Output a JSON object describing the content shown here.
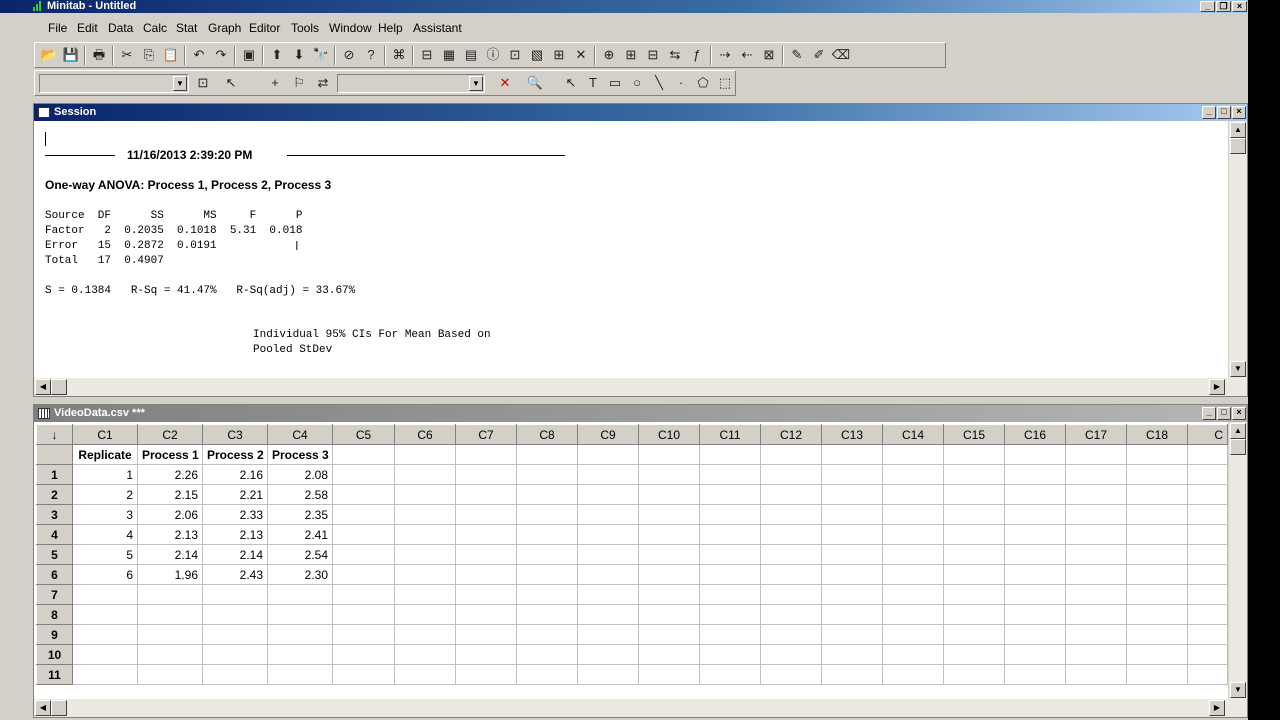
{
  "app": {
    "title": "Minitab - Untitled"
  },
  "menu": [
    "File",
    "Edit",
    "Data",
    "Calc",
    "Stat",
    "Graph",
    "Editor",
    "Tools",
    "Window",
    "Help",
    "Assistant"
  ],
  "session": {
    "title": "Session",
    "timestamp": "11/16/2013 2:39:20 PM",
    "heading": "One-way ANOVA: Process 1, Process 2, Process 3",
    "anova_lines": [
      "Source  DF      SS      MS     F      P",
      "Factor   2  0.2035  0.1018  5.31  0.018",
      "Error   15  0.2872  0.0191",
      "Total   17  0.4907"
    ],
    "summary_line": "S = 0.1384   R-Sq = 41.47%   R-Sq(adj) = 33.67%",
    "ci_lines": [
      "Individual 95% CIs For Mean Based on",
      "Pooled StDev"
    ]
  },
  "worksheet": {
    "title": "VideoData.csv ***",
    "corner_label": "↓",
    "columns": [
      "C1",
      "C2",
      "C3",
      "C4",
      "C5",
      "C6",
      "C7",
      "C8",
      "C9",
      "C10",
      "C11",
      "C12",
      "C13",
      "C14",
      "C15",
      "C16",
      "C17",
      "C18",
      "C"
    ],
    "names": [
      "Replicate",
      "Process 1",
      "Process 2",
      "Process 3",
      "",
      "",
      "",
      "",
      "",
      "",
      "",
      "",
      "",
      "",
      "",
      "",
      "",
      "",
      ""
    ],
    "row_numbers": [
      "1",
      "2",
      "3",
      "4",
      "5",
      "6",
      "7",
      "8",
      "9",
      "10",
      "11"
    ],
    "rows": [
      [
        "1",
        "2.26",
        "2.16",
        "2.08"
      ],
      [
        "2",
        "2.15",
        "2.21",
        "2.58"
      ],
      [
        "3",
        "2.06",
        "2.33",
        "2.35"
      ],
      [
        "4",
        "2.13",
        "2.13",
        "2.41"
      ],
      [
        "5",
        "2.14",
        "2.14",
        "2.54"
      ],
      [
        "6",
        "1.96",
        "2.43",
        "2.30"
      ],
      [
        "",
        "",
        "",
        ""
      ],
      [
        "",
        "",
        "",
        ""
      ],
      [
        "",
        "",
        "",
        ""
      ],
      [
        "",
        "",
        "",
        ""
      ],
      [
        "",
        "",
        "",
        ""
      ]
    ]
  },
  "toolbar1_icons": [
    "open-icon",
    "save-icon",
    "print-icon",
    "cut-icon",
    "copy-icon",
    "paste-icon",
    "undo-icon",
    "redo-icon",
    "edit-last-dialog-icon",
    "previous-command-icon",
    "next-command-icon",
    "find-icon",
    "cancel-icon",
    "help-icon",
    "stat-guide-icon",
    "session-window-icon",
    "worksheet-icon",
    "graph-folder-icon",
    "info-icon",
    "history-icon",
    "report-pad-icon",
    "related-documents-icon",
    "manage-graphs-icon",
    "insert-cells-icon",
    "insert-rows-icon",
    "insert-columns-icon",
    "move-columns-icon",
    "define-formula-icon",
    "add-rows-icon",
    "delete-rows-icon",
    "clear-cells-icon",
    "brush-icon",
    "set-id-icon",
    "eraser-icon"
  ],
  "toolbar1_glyphs": [
    "📂",
    "💾",
    "🖶",
    "✂",
    "⎘",
    "📋",
    "↶",
    "↷",
    "▣",
    "⬆",
    "⬇",
    "🔭",
    "⊘",
    "?",
    "⌘",
    "⊟",
    "▦",
    "▤",
    "ⓘ",
    "⊡",
    "▧",
    "⊞",
    "✕",
    "⊕",
    "⊞",
    "⊟",
    "⇆",
    "ƒ",
    "⇢",
    "⇠",
    "⊠",
    "✎",
    "✐",
    "⌫"
  ],
  "toolbar2_icons": [
    "brush-icon",
    "select-icon",
    "crosshair-icon",
    "flag-icon",
    "swap-icon",
    "delete-icon",
    "zoom-icon",
    "pointer-icon",
    "text-icon",
    "rectangle-icon",
    "ellipse-icon",
    "line-icon",
    "dot-icon",
    "polygon-icon",
    "marker-icon"
  ],
  "toolbar2_glyphs": [
    "⊡",
    "↖",
    "+",
    "⚐",
    "⇄",
    "✕",
    "🔍",
    "↖",
    "T",
    "▭",
    "○",
    "╲",
    "·",
    "⬠",
    "⬚"
  ],
  "colors": {
    "title_active": "#0a246a",
    "title_light": "#a6caf0",
    "chrome": "#d4d0c8"
  }
}
